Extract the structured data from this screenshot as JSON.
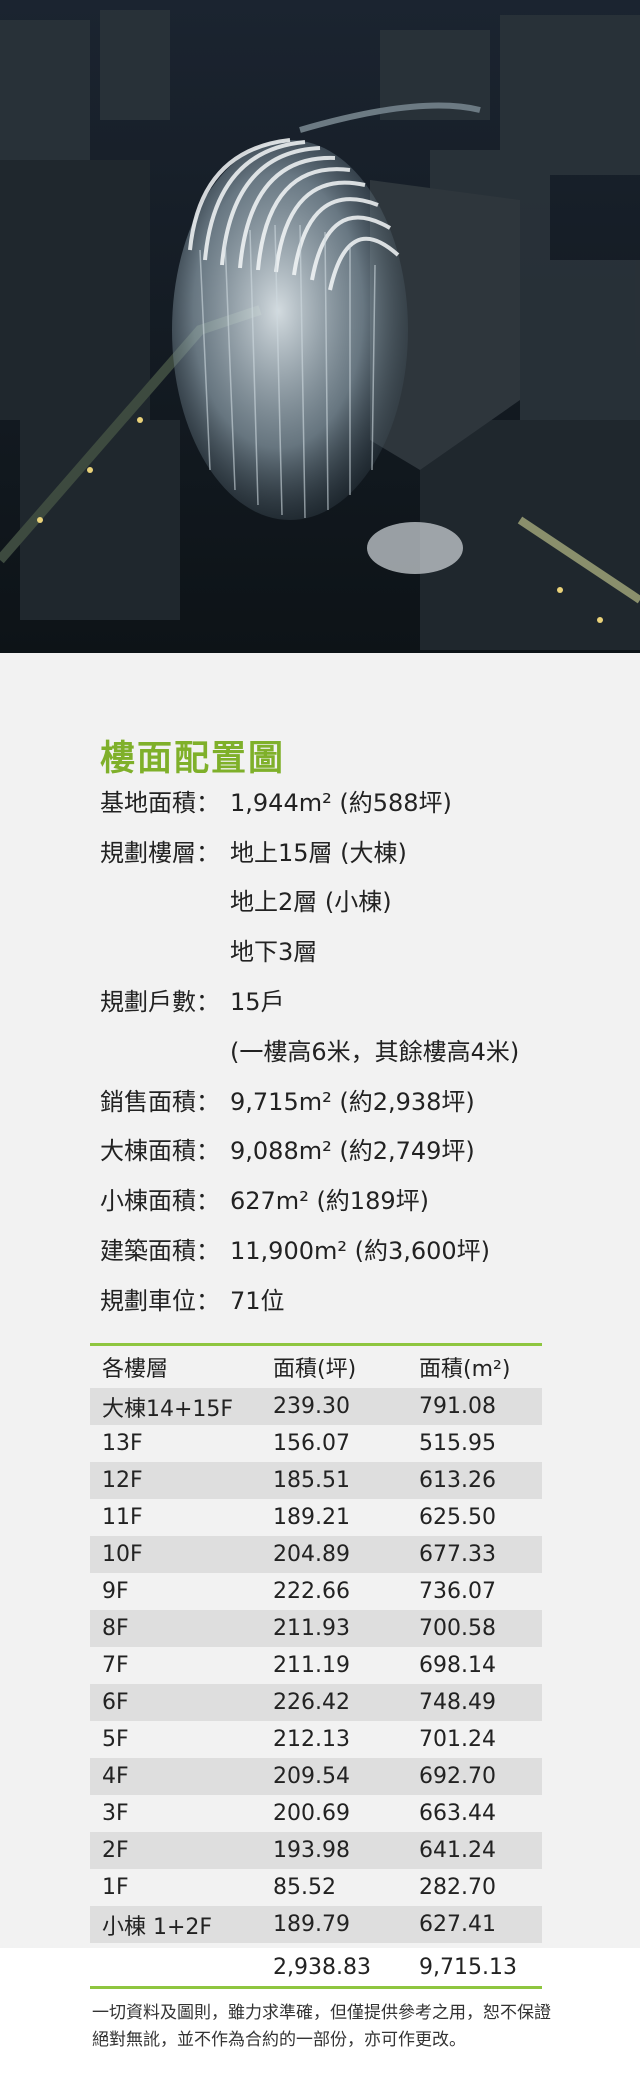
{
  "title": "樓面配置圖",
  "specs": [
    {
      "label": "基地面積：",
      "value": "1,944m² (約588坪)"
    },
    {
      "label": "規劃樓層：",
      "value": "地上15層 (大棟)",
      "cont": [
        "地上2層 (小棟)",
        "地下3層"
      ]
    },
    {
      "label": "規劃戶數：",
      "value": "15戶",
      "cont": [
        "(一樓高6米，其餘樓高4米)"
      ]
    },
    {
      "label": "銷售面積：",
      "value": "9,715m² (約2,938坪)"
    },
    {
      "label": "大棟面積：",
      "value": "9,088m² (約2,749坪)"
    },
    {
      "label": "小棟面積：",
      "value": "627m² (約189坪)"
    },
    {
      "label": "建築面積：",
      "value": "11,900m² (約3,600坪)"
    },
    {
      "label": "規劃車位：",
      "value": "71位"
    }
  ],
  "table": {
    "headers": [
      "各樓層",
      "面積(坪)",
      "面積(m²)"
    ],
    "rows": [
      [
        "大棟14+15F",
        "239.30",
        "791.08"
      ],
      [
        "13F",
        "156.07",
        "515.95"
      ],
      [
        "12F",
        "185.51",
        "613.26"
      ],
      [
        "11F",
        "189.21",
        "625.50"
      ],
      [
        "10F",
        "204.89",
        "677.33"
      ],
      [
        "9F",
        "222.66",
        "736.07"
      ],
      [
        "8F",
        "211.93",
        "700.58"
      ],
      [
        "7F",
        "211.19",
        "698.14"
      ],
      [
        "6F",
        "226.42",
        "748.49"
      ],
      [
        "5F",
        "212.13",
        "701.24"
      ],
      [
        "4F",
        "209.54",
        "692.70"
      ],
      [
        "3F",
        "200.69",
        "663.44"
      ],
      [
        "2F",
        "193.98",
        "641.24"
      ],
      [
        "1F",
        "85.52",
        "282.70"
      ],
      [
        "小棟 1+2F",
        "189.79",
        "627.41"
      ]
    ],
    "total": [
      "",
      "2,938.83",
      "9,715.13"
    ]
  },
  "disclaimer": "一切資料及圖則，雖力求準確，但僅提供參考之用，恕不保證絕對無訛，並不作為合約的一部份，亦可作更改。",
  "colors": {
    "accent": "#7fb02a",
    "rule": "#8ec63f",
    "shade": "#dedede"
  }
}
